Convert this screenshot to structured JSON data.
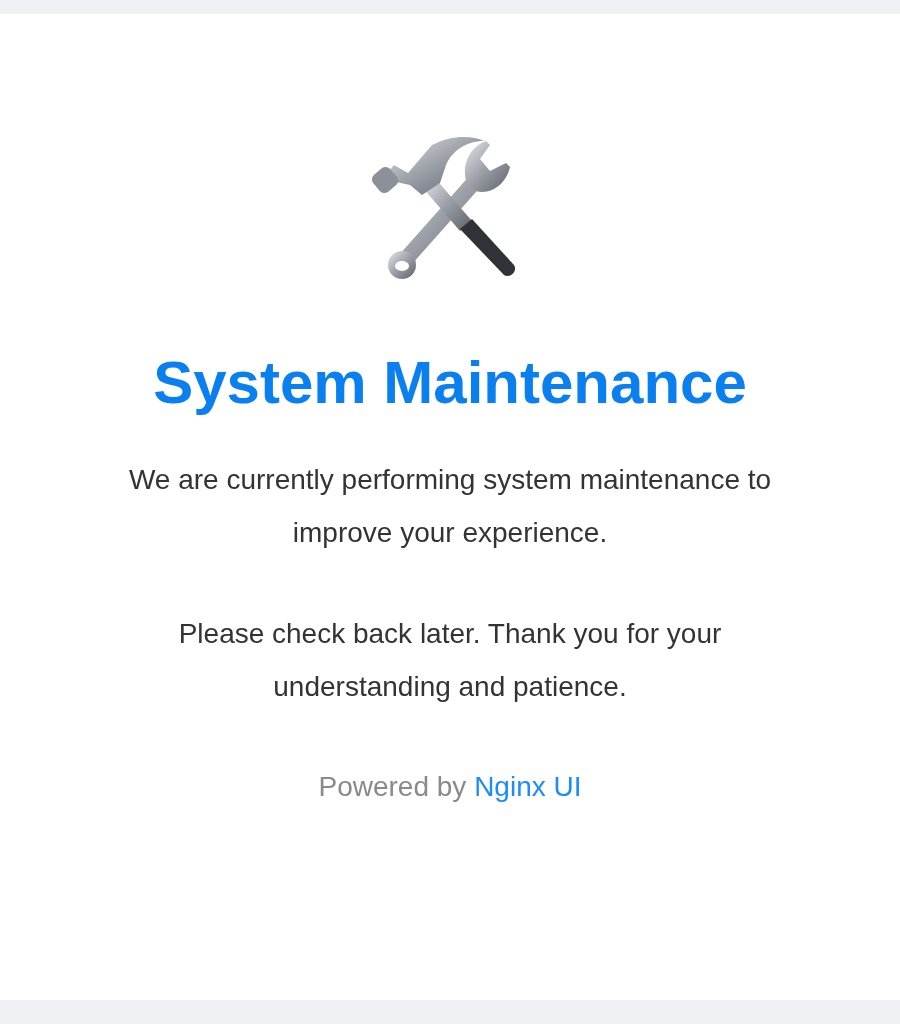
{
  "title": "System Maintenance",
  "paragraphs": [
    "We are currently performing system maintenance to improve your experience.",
    "Please check back later. Thank you for your understanding and patience."
  ],
  "footer": {
    "text": "Powered by",
    "link": "Nginx UI"
  }
}
